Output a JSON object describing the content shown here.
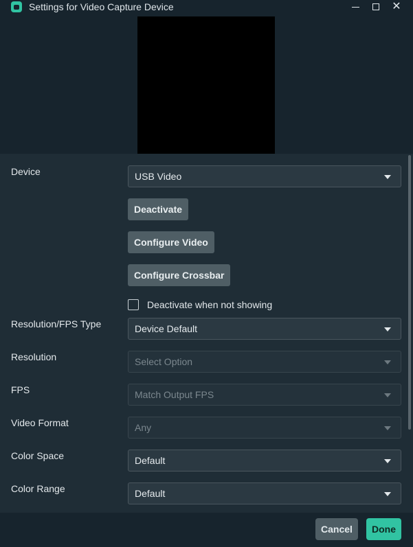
{
  "window": {
    "title": "Settings for Video Capture Device",
    "controls": {
      "minimize": "—",
      "maximize": "□",
      "close": "✕"
    }
  },
  "fields": {
    "device": {
      "label": "Device",
      "value": "USB Video"
    },
    "resolution_fps_type": {
      "label": "Resolution/FPS Type",
      "value": "Device Default"
    },
    "resolution": {
      "label": "Resolution",
      "value": "Select Option"
    },
    "fps": {
      "label": "FPS",
      "value": "Match Output FPS"
    },
    "video_format": {
      "label": "Video Format",
      "value": "Any"
    },
    "color_space": {
      "label": "Color Space",
      "value": "Default"
    },
    "color_range": {
      "label": "Color Range",
      "value": "Default"
    }
  },
  "buttons": {
    "deactivate": "Deactivate",
    "configure_video": "Configure Video",
    "configure_crossbar": "Configure Crossbar"
  },
  "checkbox": {
    "label": "Deactivate when not showing",
    "checked": false
  },
  "footer": {
    "cancel": "Cancel",
    "done": "Done"
  },
  "colors": {
    "accent": "#31c3a2",
    "background": "#17242d",
    "panel": "#1f2d36"
  }
}
